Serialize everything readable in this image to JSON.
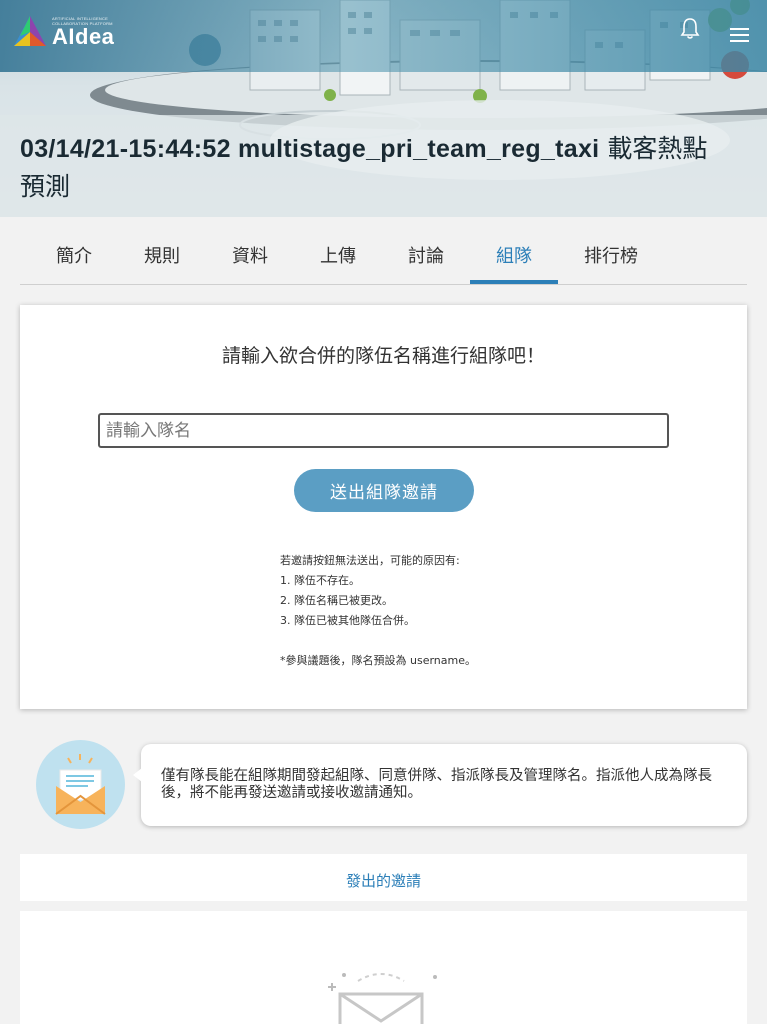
{
  "header": {
    "logo_small_line1": "ARTIFICIAL INTELLIGENCE",
    "logo_small_line2": "COLLABORATION PLATFORM",
    "logo_text": "AIdea",
    "title_code": "03/14/21-15:44:52 multistage_pri_team_reg_taxi",
    "title_cjk_1": " 載客熱點",
    "title_cjk_2": "預測"
  },
  "tabs": [
    {
      "label": "簡介"
    },
    {
      "label": "規則"
    },
    {
      "label": "資料"
    },
    {
      "label": "上傳"
    },
    {
      "label": "討論"
    },
    {
      "label": "組隊",
      "active": true
    },
    {
      "label": "排行榜"
    }
  ],
  "invite": {
    "title": "請輸入欲合併的隊伍名稱進行組隊吧！",
    "input_placeholder": "請輸入隊名",
    "input_value": "",
    "send_label": "送出組隊邀請",
    "notes_intro": "若邀請按鈕無法送出，可能的原因有:",
    "notes": [
      "1. 隊伍不存在。",
      "2. 隊伍名稱已被更改。",
      "3. 隊伍已被其他隊伍合併。"
    ],
    "notes_footer": "*參與議題後，隊名預設為 username。"
  },
  "notice": {
    "text": "僅有隊長能在組隊期間發起組隊、同意併隊、指派隊長及管理隊名。指派他人成為隊長後，將不能再發送邀請或接收邀請通知。"
  },
  "sent": {
    "header": "發出的邀請"
  },
  "colors": {
    "accent": "#2c7fb8",
    "button": "#5b9ec4",
    "topbar": "#3a7896"
  },
  "icons": {
    "bell": "bell-icon",
    "menu": "hamburger-menu-icon",
    "notice": "envelope-notice-icon",
    "empty": "empty-mail-icon"
  }
}
